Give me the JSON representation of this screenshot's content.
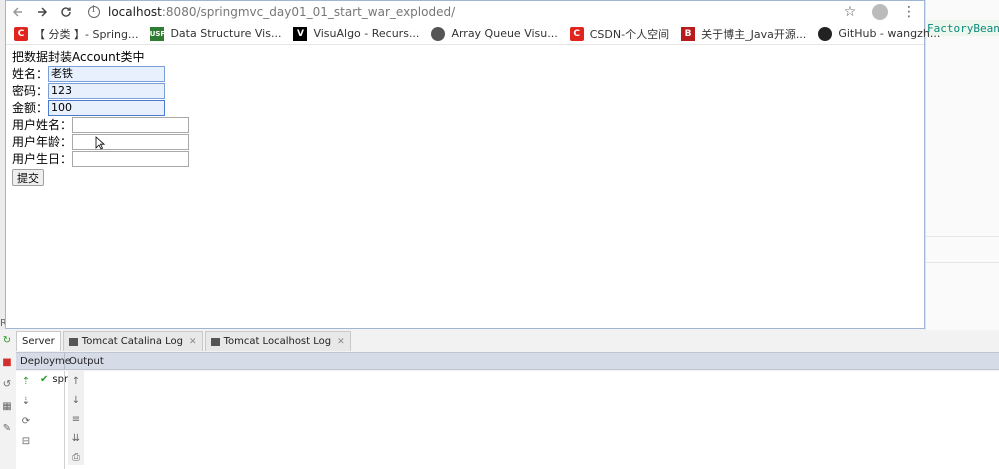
{
  "browser": {
    "url_host": "localhost",
    "url_path": ":8080/springmvc_day01_01_start_war_exploded/",
    "bookmarks": [
      {
        "icon": "csdn-icon",
        "label": "【 分类 】- Spring..."
      },
      {
        "icon": "usf-icon",
        "label": "Data Structure Vis..."
      },
      {
        "icon": "visualgo-icon",
        "label": "VisuAlgo - Recurs..."
      },
      {
        "icon": "globe-icon",
        "label": "Array Queue Visu..."
      },
      {
        "icon": "csdn-icon",
        "label": "CSDN-个人空间"
      },
      {
        "icon": "blog-icon",
        "label": "关于博主_Java开源..."
      },
      {
        "icon": "github-icon",
        "label": "GitHub - wangzh..."
      }
    ]
  },
  "form": {
    "title": "把数据封装Account类中",
    "fields": [
      {
        "label": "姓名：",
        "value": "老铁"
      },
      {
        "label": "密码：",
        "value": "123"
      },
      {
        "label": "金额：",
        "value": "100"
      },
      {
        "label": "用户姓名：",
        "value": ""
      },
      {
        "label": "用户年龄：",
        "value": ""
      },
      {
        "label": "用户生日：",
        "value": ""
      }
    ],
    "submit_label": "提交"
  },
  "ide": {
    "code_snippet": "FactoryBean\"",
    "r_label": "R",
    "tabs": [
      {
        "label": "Server",
        "active": true
      },
      {
        "label": "Tomcat Catalina Log",
        "active": false
      },
      {
        "label": "Tomcat Localhost Log",
        "active": false
      }
    ],
    "header_cols": [
      "Deployme",
      "Output"
    ],
    "deploy_item": "spr"
  }
}
